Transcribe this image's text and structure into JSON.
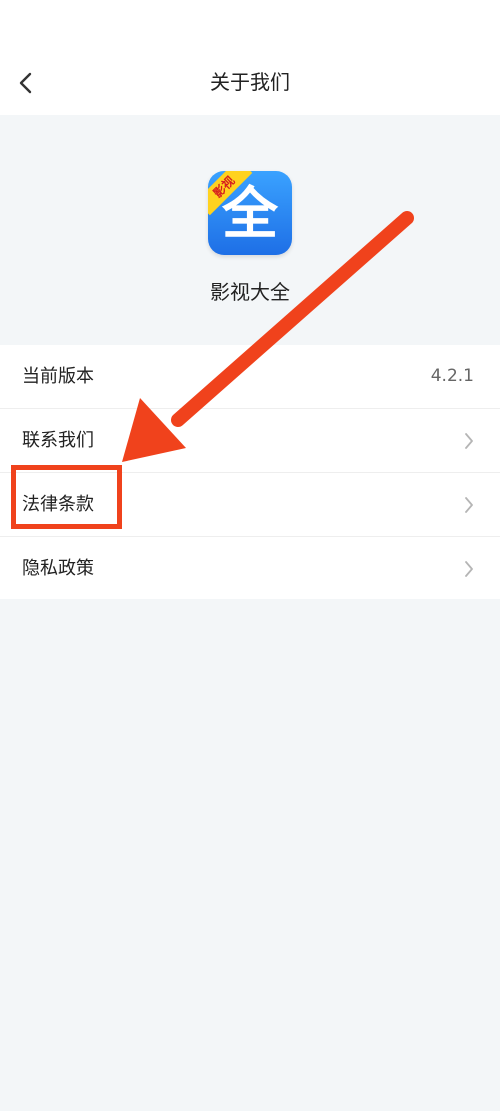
{
  "header": {
    "title": "关于我们",
    "back_icon": "chevron-left-icon"
  },
  "app": {
    "name": "影视大全",
    "icon_glyph": "全",
    "icon_ribbon": "影视"
  },
  "list": {
    "items": [
      {
        "label": "当前版本",
        "value": "4.2.1"
      },
      {
        "label": "联系我们",
        "icon": "chevron-right-icon"
      },
      {
        "label": "法律条款",
        "icon": "chevron-right-icon"
      },
      {
        "label": "隐私政策",
        "icon": "chevron-right-icon"
      }
    ]
  },
  "annotation": {
    "color": "#f0421c"
  }
}
